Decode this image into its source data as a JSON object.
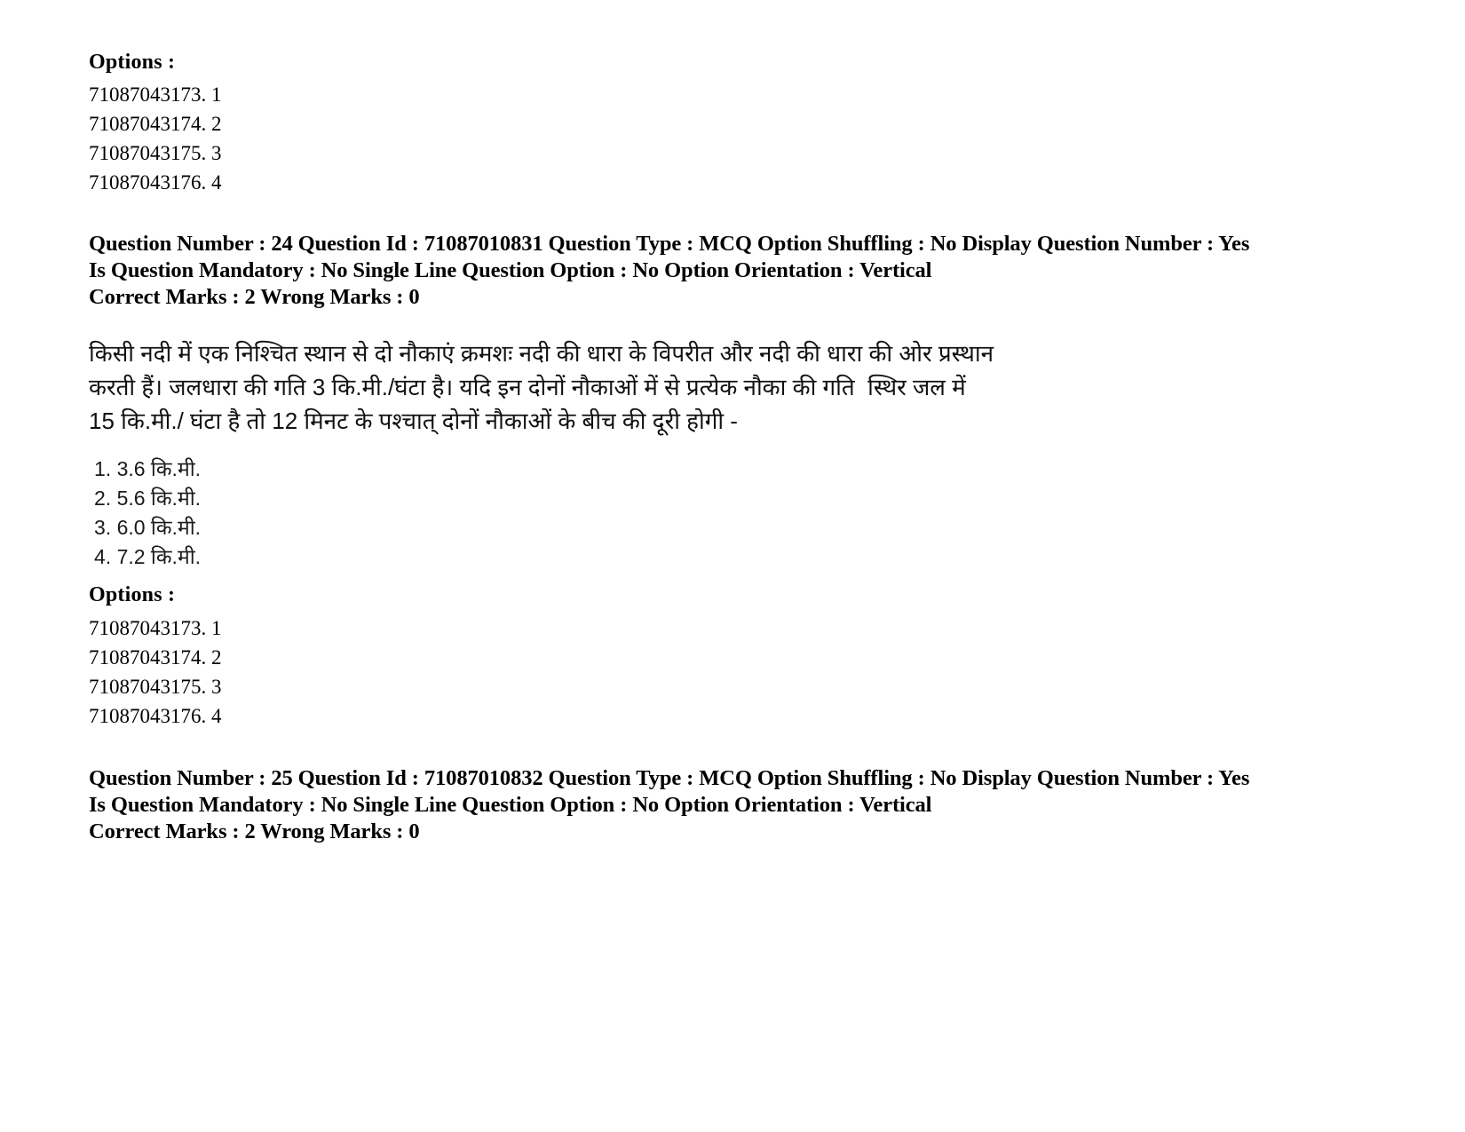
{
  "document": {
    "options_label": "Options :",
    "question_24": {
      "meta_line": "Question Number : 24 Question Id : 71087010831 Question Type : MCQ Option Shuffling : No Display Question Number : Yes Is Question Mandatory : No Single Line Question Option : No Option Orientation : Vertical",
      "marks_line": "Correct Marks : 2 Wrong Marks : 0",
      "number": "24",
      "question_id": "71087010831",
      "question_type": "MCQ",
      "option_shuffling": "No",
      "display_question_number": "Yes",
      "is_question_mandatory": "No",
      "single_line_question_option": "No",
      "option_orientation": "Vertical",
      "correct_marks": "2",
      "wrong_marks": "0",
      "body_lines": [
        "किसी नदी में एक निश्चित स्थान से दो नौकाएं क्रमशः नदी की धारा के विपरीत और नदी की धारा की ओर प्रस्थान",
        "करती हैं। जलधारा की गति 3 कि.मी./घंटा है। यदि इन दोनों नौकाओं में से प्रत्येक नौका की गति  स्थिर जल में",
        "15 कि.मी./ घंटा है तो 12 मिनट के पश्चात् दोनों नौकाओं के बीच की दूरी होगी -"
      ],
      "choices": [
        "1. 3.6 कि.मी.",
        "2. 5.6 कि.मी.",
        "3. 6.0 कि.मी.",
        "4. 7.2 कि.मी."
      ],
      "option_ids": [
        "71087043173. 1",
        "71087043174. 2",
        "71087043175. 3",
        "71087043176. 4"
      ]
    },
    "question_23_trailing_options": {
      "option_ids": [
        "71087043173. 1",
        "71087043174. 2",
        "71087043175. 3",
        "71087043176. 4"
      ]
    },
    "question_25": {
      "meta_line": "Question Number : 25 Question Id : 71087010832 Question Type : MCQ Option Shuffling : No Display Question Number : Yes Is Question Mandatory : No Single Line Question Option : No Option Orientation : Vertical",
      "marks_line": "Correct Marks : 2 Wrong Marks : 0",
      "number": "25",
      "question_id": "71087010832",
      "question_type": "MCQ",
      "option_shuffling": "No",
      "display_question_number": "Yes",
      "is_question_mandatory": "No",
      "single_line_question_option": "No",
      "option_orientation": "Vertical",
      "correct_marks": "2",
      "wrong_marks": "0"
    }
  }
}
